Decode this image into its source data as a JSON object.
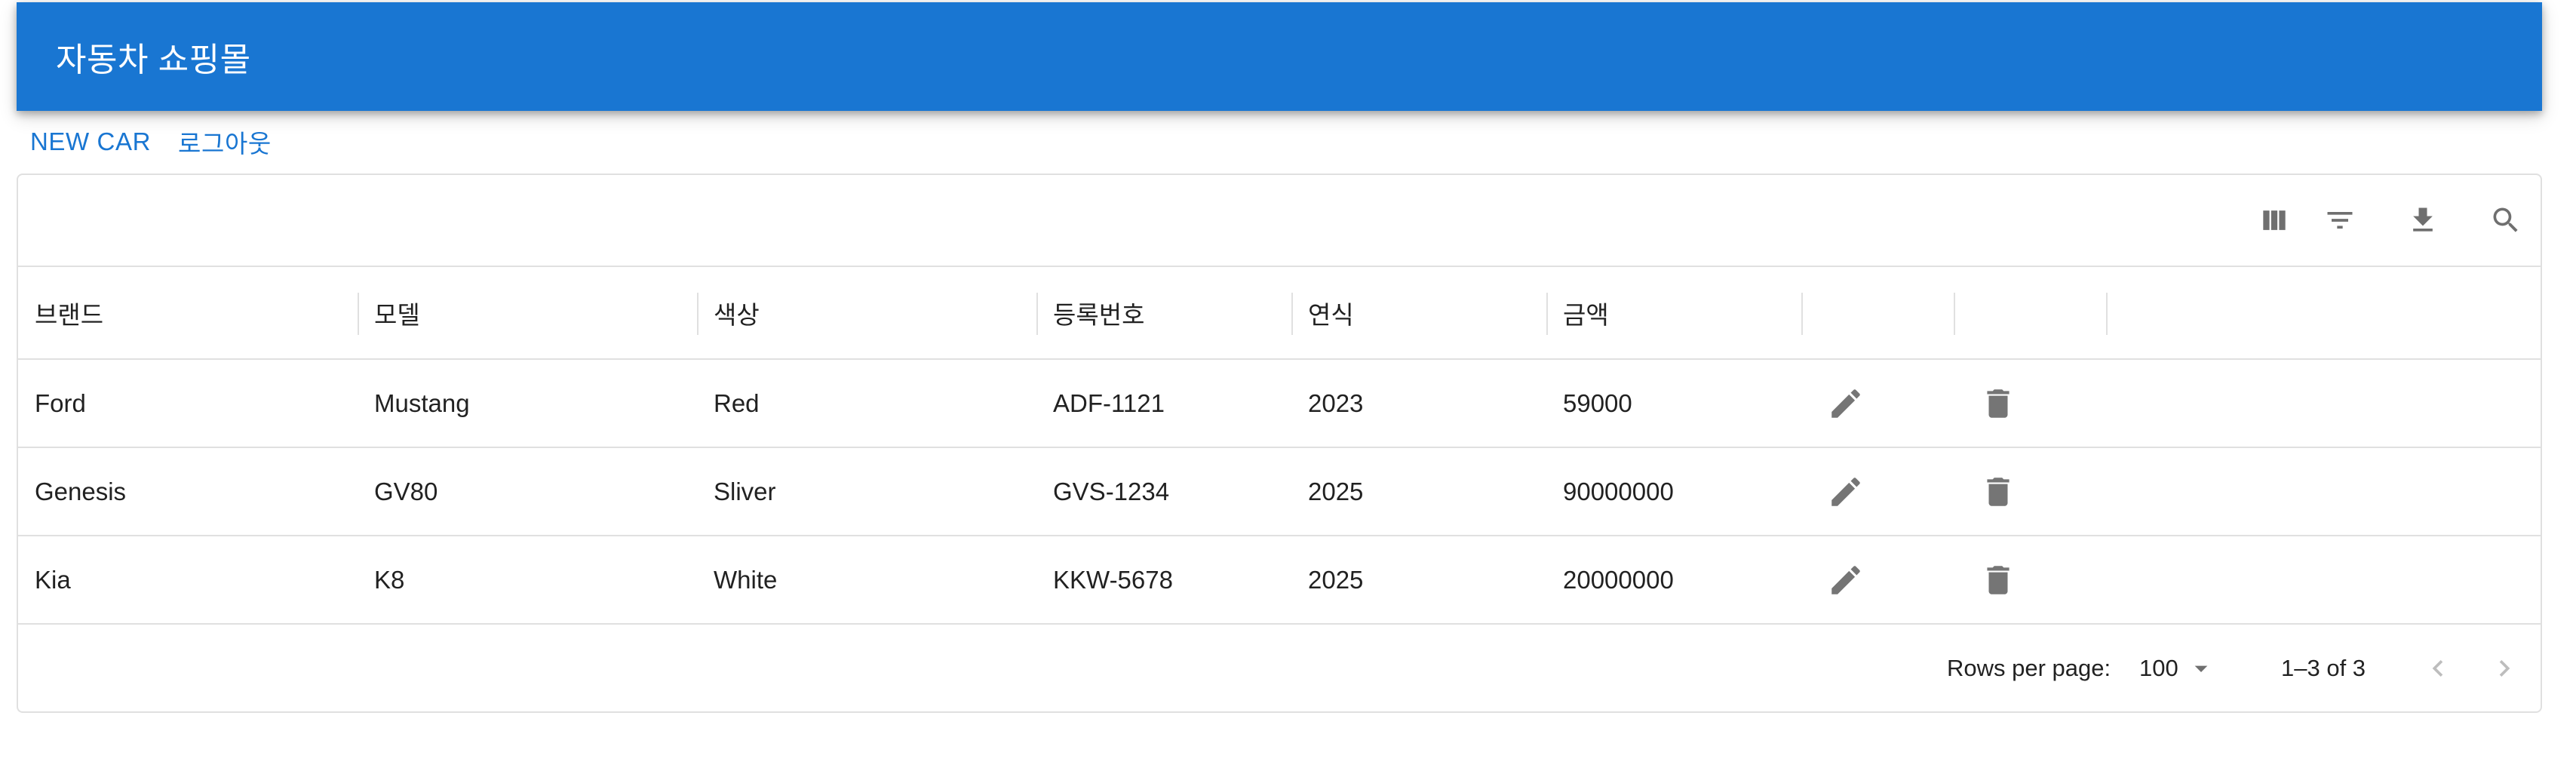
{
  "app": {
    "title": "자동차 쇼핑몰"
  },
  "nav": {
    "new_car": "NEW CAR",
    "logout": "로그아웃"
  },
  "toolbar": {
    "columns_icon": "view-column-icon",
    "filter_icon": "filter-list-icon",
    "export_icon": "download-icon",
    "search_icon": "search-icon"
  },
  "table": {
    "columns": [
      "브랜드",
      "모델",
      "색상",
      "등록번호",
      "연식",
      "금액",
      "",
      ""
    ],
    "rows": [
      {
        "brand": "Ford",
        "model": "Mustang",
        "color": "Red",
        "registration_number": "ADF-1121",
        "year": "2023",
        "price": "59000"
      },
      {
        "brand": "Genesis",
        "model": "GV80",
        "color": "Sliver",
        "registration_number": "GVS-1234",
        "year": "2025",
        "price": "90000000"
      },
      {
        "brand": "Kia",
        "model": "K8",
        "color": "White",
        "registration_number": "KKW-5678",
        "year": "2025",
        "price": "20000000"
      }
    ],
    "row_actions": {
      "edit_icon": "edit-icon",
      "delete_icon": "delete-icon"
    }
  },
  "pagination": {
    "rows_per_page_label": "Rows per page:",
    "rows_per_page_value": "100",
    "range_text": "1–3 of 3",
    "prev_icon": "chevron-left-icon",
    "next_icon": "chevron-right-icon"
  },
  "colors": {
    "appbar": "#1976d2",
    "link": "#1976d2",
    "icon": "#757575",
    "border": "#e0e0e0"
  }
}
